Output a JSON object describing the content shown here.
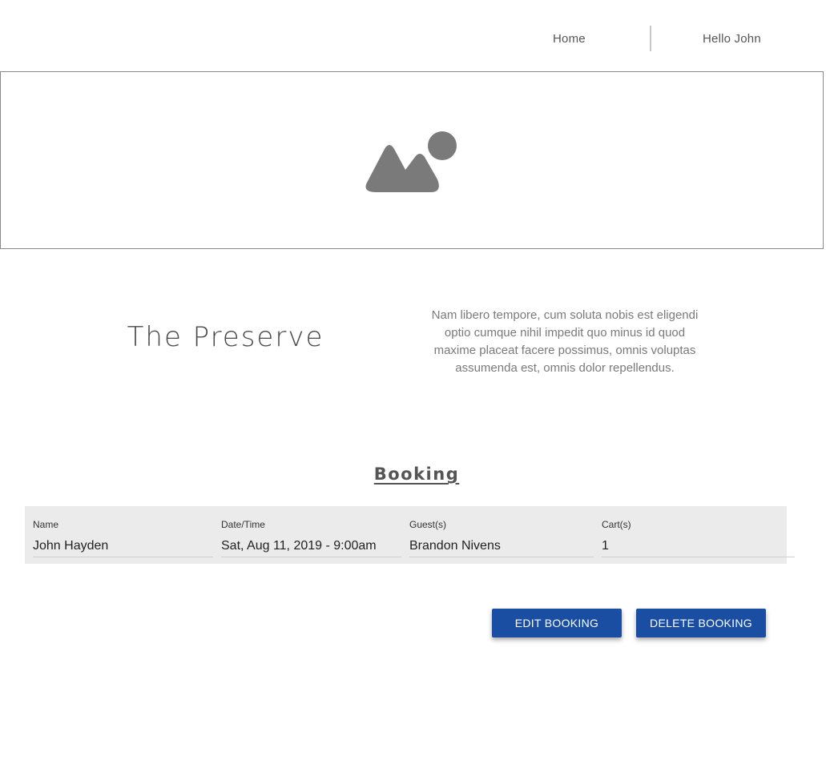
{
  "nav": {
    "home_label": "Home",
    "user_label": "Hello John"
  },
  "hero": {
    "image_icon": "image-placeholder-icon"
  },
  "venue": {
    "title": "The Preserve",
    "description": "Nam libero tempore, cum soluta nobis est eligendi optio cumque nihil impedit quo minus id quod maxime placeat facere possimus, omnis voluptas assumenda est, omnis dolor repellendus."
  },
  "booking": {
    "section_title": "Booking",
    "fields": [
      {
        "label": "Name",
        "value": "John Hayden"
      },
      {
        "label": "Date/Time",
        "value": "Sat, Aug 11, 2019 - 9:00am"
      },
      {
        "label": "Guest(s)",
        "value": "Brandon Nivens"
      },
      {
        "label": "Cart(s)",
        "value": "1"
      }
    ],
    "edit_label": "Edit Booking",
    "delete_label": "Delete Booking"
  },
  "colors": {
    "primary_button": "#1a4ea3",
    "panel_background": "#ebebeb",
    "icon_gray": "#7a7a7a"
  }
}
